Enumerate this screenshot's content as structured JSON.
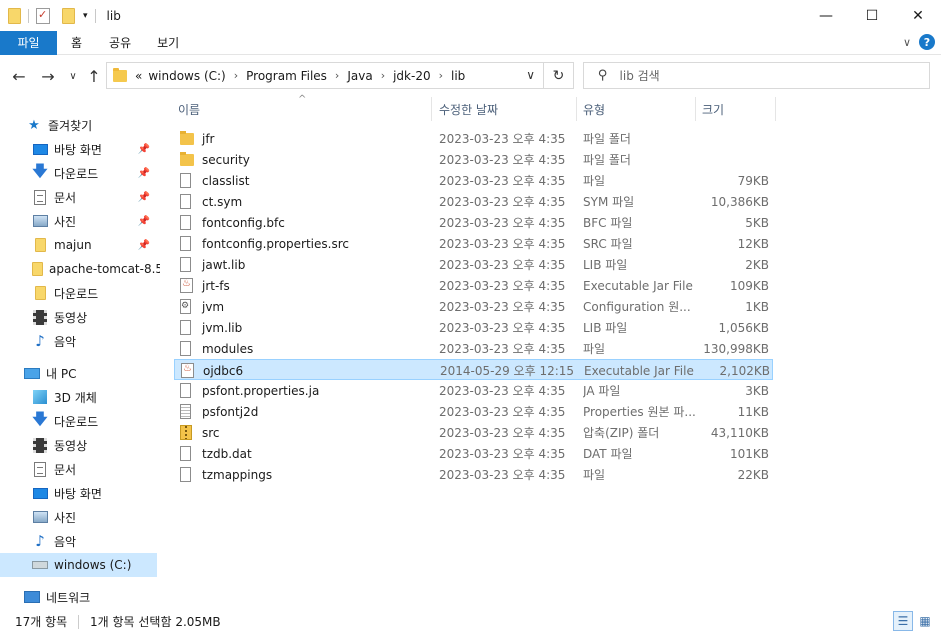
{
  "window": {
    "title": "lib",
    "minimize": "—",
    "maximize": "☐",
    "close": "✕"
  },
  "ribbon": {
    "tabs": [
      "파일",
      "홈",
      "공유",
      "보기"
    ],
    "expand_chevron": "∨",
    "help": "?"
  },
  "nav": {
    "back": "←",
    "forward": "→",
    "recent": "∨",
    "up": "↑",
    "breadcrumb_overflow": "«",
    "breadcrumb": [
      "windows (C:)",
      "Program Files",
      "Java",
      "jdk-20",
      "lib"
    ],
    "refresh": "↻",
    "search_placeholder": "lib 검색"
  },
  "sidebar": {
    "quick_access": "즐겨찾기",
    "quick_items": [
      "바탕 화면",
      "다운로드",
      "문서",
      "사진",
      "majun",
      "apache-tomcat-8.5",
      "다운로드",
      "동영상",
      "음악"
    ],
    "this_pc": "내 PC",
    "pc_items": [
      "3D 개체",
      "다운로드",
      "동영상",
      "문서",
      "바탕 화면",
      "사진",
      "음악",
      "windows (C:)"
    ],
    "network": "네트워크"
  },
  "columns": {
    "name": "이름",
    "date": "수정한 날짜",
    "type": "유형",
    "size": "크기"
  },
  "files": [
    {
      "name": "jfr",
      "date": "2023-03-23 오후 4:35",
      "type": "파일 폴더",
      "size": "",
      "icon": "folder"
    },
    {
      "name": "security",
      "date": "2023-03-23 오후 4:35",
      "type": "파일 폴더",
      "size": "",
      "icon": "folder"
    },
    {
      "name": "classlist",
      "date": "2023-03-23 오후 4:35",
      "type": "파일",
      "size": "79KB",
      "icon": "file"
    },
    {
      "name": "ct.sym",
      "date": "2023-03-23 오후 4:35",
      "type": "SYM 파일",
      "size": "10,386KB",
      "icon": "file"
    },
    {
      "name": "fontconfig.bfc",
      "date": "2023-03-23 오후 4:35",
      "type": "BFC 파일",
      "size": "5KB",
      "icon": "file"
    },
    {
      "name": "fontconfig.properties.src",
      "date": "2023-03-23 오후 4:35",
      "type": "SRC 파일",
      "size": "12KB",
      "icon": "file"
    },
    {
      "name": "jawt.lib",
      "date": "2023-03-23 오후 4:35",
      "type": "LIB 파일",
      "size": "2KB",
      "icon": "file"
    },
    {
      "name": "jrt-fs",
      "date": "2023-03-23 오후 4:35",
      "type": "Executable Jar File",
      "size": "109KB",
      "icon": "jar"
    },
    {
      "name": "jvm",
      "date": "2023-03-23 오후 4:35",
      "type": "Configuration 원...",
      "size": "1KB",
      "icon": "cfg"
    },
    {
      "name": "jvm.lib",
      "date": "2023-03-23 오후 4:35",
      "type": "LIB 파일",
      "size": "1,056KB",
      "icon": "file"
    },
    {
      "name": "modules",
      "date": "2023-03-23 오후 4:35",
      "type": "파일",
      "size": "130,998KB",
      "icon": "file"
    },
    {
      "name": "ojdbc6",
      "date": "2014-05-29 오후 12:15",
      "type": "Executable Jar File",
      "size": "2,102KB",
      "icon": "jar",
      "selected": true
    },
    {
      "name": "psfont.properties.ja",
      "date": "2023-03-23 오후 4:35",
      "type": "JA 파일",
      "size": "3KB",
      "icon": "file"
    },
    {
      "name": "psfontj2d",
      "date": "2023-03-23 오후 4:35",
      "type": "Properties 원본 파...",
      "size": "11KB",
      "icon": "txt"
    },
    {
      "name": "src",
      "date": "2023-03-23 오후 4:35",
      "type": "압축(ZIP) 폴더",
      "size": "43,110KB",
      "icon": "zip"
    },
    {
      "name": "tzdb.dat",
      "date": "2023-03-23 오후 4:35",
      "type": "DAT 파일",
      "size": "101KB",
      "icon": "file"
    },
    {
      "name": "tzmappings",
      "date": "2023-03-23 오후 4:35",
      "type": "파일",
      "size": "22KB",
      "icon": "file"
    }
  ],
  "status": {
    "item_count": "17개 항목",
    "selection": "1개 항목 선택함 2.05MB"
  }
}
